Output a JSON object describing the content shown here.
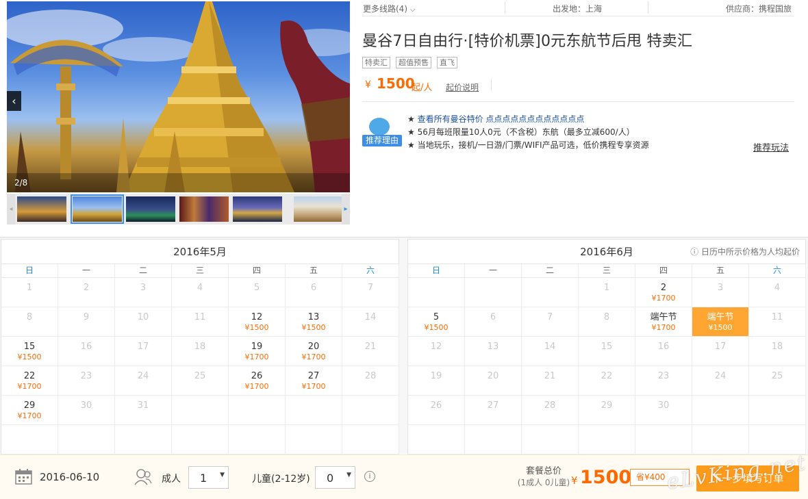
{
  "gallery": {
    "counter": "2/8",
    "prev_label": "‹",
    "thumbs": [
      "wat-arun-night",
      "golden-chedi",
      "night-lake",
      "dancers",
      "grand-palace-night",
      "temple-white"
    ]
  },
  "meta": {
    "more_routes": "更多线路(4)",
    "departure": "出发地：上海",
    "supplier": "供应商：携程国旅"
  },
  "title": "曼谷7日自由行·[特价机票]0元东航节后甩 特卖汇",
  "tags": [
    "特卖汇",
    "超值预售",
    "直飞"
  ],
  "price": {
    "currency": "¥",
    "amount": "1500",
    "unit": "起/人",
    "explain": "起价说明"
  },
  "reason": {
    "badge": "推荐理由",
    "lines": [
      {
        "star": "★",
        "text": "查看所有曼谷特价 点点点点点点点点点点点点",
        "link": true
      },
      {
        "star": "★",
        "text": "56月每班限量10人0元（不含税）东航（最多立减600/人）",
        "link": false
      },
      {
        "star": "★",
        "text": "当地玩乐，接机/一日游/门票/WIFI产品可选，低价携程专享资源",
        "link": false
      }
    ],
    "more": "推荐玩法"
  },
  "calendar": {
    "note": "日历中所示价格为人均起价",
    "weekdays": [
      "日",
      "一",
      "二",
      "三",
      "四",
      "五",
      "六"
    ],
    "months": [
      {
        "title": "2016年5月",
        "rows": [
          [
            {
              "d": "1"
            },
            {
              "d": "2"
            },
            {
              "d": "3"
            },
            {
              "d": "4"
            },
            {
              "d": "5"
            },
            {
              "d": "6"
            },
            {
              "d": "7"
            }
          ],
          [
            {
              "d": "8"
            },
            {
              "d": "9"
            },
            {
              "d": "10"
            },
            {
              "d": "11"
            },
            {
              "d": "12",
              "p": "¥1500"
            },
            {
              "d": "13",
              "p": "¥1500"
            },
            {
              "d": "14"
            }
          ],
          [
            {
              "d": "15",
              "p": "¥1500"
            },
            {
              "d": "16"
            },
            {
              "d": "17"
            },
            {
              "d": "18"
            },
            {
              "d": "19",
              "p": "¥1700"
            },
            {
              "d": "20",
              "p": "¥1700"
            },
            {
              "d": "21"
            }
          ],
          [
            {
              "d": "22",
              "p": "¥1700"
            },
            {
              "d": "23"
            },
            {
              "d": "24"
            },
            {
              "d": "25"
            },
            {
              "d": "26",
              "p": "¥1700"
            },
            {
              "d": "27",
              "p": "¥1700"
            },
            {
              "d": "28"
            }
          ],
          [
            {
              "d": "29",
              "p": "¥1700"
            },
            {
              "d": "30"
            },
            {
              "d": "31"
            },
            {},
            {},
            {},
            {}
          ],
          [
            {},
            {},
            {},
            {},
            {},
            {},
            {}
          ]
        ]
      },
      {
        "title": "2016年6月",
        "rows": [
          [
            {},
            {},
            {},
            {
              "d": "1"
            },
            {
              "d": "2",
              "p": "¥1700"
            },
            {
              "d": "3"
            },
            {
              "d": "4"
            }
          ],
          [
            {
              "d": "5",
              "p": "¥1500"
            },
            {
              "d": "6"
            },
            {
              "d": "7"
            },
            {
              "d": "8"
            },
            {
              "d": "端午节",
              "p": "¥1700"
            },
            {
              "d": "端午节",
              "p": "¥1500",
              "sel": true
            },
            {
              "d": "11"
            }
          ],
          [
            {
              "d": "12"
            },
            {
              "d": "13"
            },
            {
              "d": "14"
            },
            {
              "d": "15"
            },
            {
              "d": "16"
            },
            {
              "d": "17"
            },
            {
              "d": "18"
            }
          ],
          [
            {
              "d": "19"
            },
            {
              "d": "20"
            },
            {
              "d": "21"
            },
            {
              "d": "22"
            },
            {
              "d": "23"
            },
            {
              "d": "24"
            },
            {
              "d": "25"
            }
          ],
          [
            {
              "d": "26"
            },
            {
              "d": "27"
            },
            {
              "d": "28"
            },
            {
              "d": "29"
            },
            {
              "d": "30"
            },
            {},
            {}
          ],
          [
            {},
            {},
            {},
            {},
            {},
            {},
            {}
          ]
        ]
      }
    ]
  },
  "booking": {
    "date": "2016-06-10",
    "adult_label": "成人",
    "adult_value": "1",
    "child_label": "儿童(2-12岁)",
    "child_value": "0",
    "total_label": "套餐总价",
    "total_sub": "(1成人 0儿童)",
    "total_currency": "¥",
    "total_amount": "1500",
    "save_label": "省¥400",
    "next_label": "下一步填写订单",
    "watermark": "eLvKing.net"
  },
  "colors": {
    "accent": "#ff6a00",
    "selected": "#ffa531",
    "link": "#1a4f9e",
    "weekend": "#1e8bd6"
  }
}
